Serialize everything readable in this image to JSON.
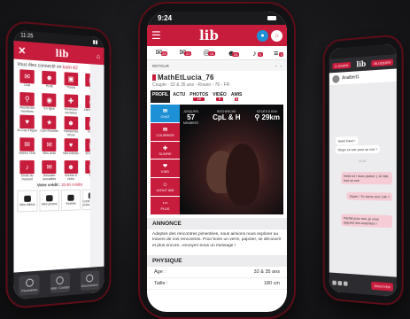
{
  "left": {
    "status_time": "11:25",
    "logo": "lib",
    "connected_text": "Vous êtes connecté en",
    "connected_user": "karin-62",
    "grid": [
      {
        "icon": "chat-icon",
        "label": "Chat"
      },
      {
        "icon": "user-icon",
        "label": "Profil"
      },
      {
        "icon": "photo-icon",
        "label": "Photos"
      },
      {
        "icon": "calendar-icon",
        "label": "Sort"
      },
      {
        "icon": "search-icon",
        "label": "Recherche membres"
      },
      {
        "icon": "online-icon",
        "label": "En ligne"
      },
      {
        "icon": "new-icon",
        "label": "Nouveaux membres"
      },
      {
        "icon": "eye-icon",
        "label": "J'aime vu ton"
      },
      {
        "icon": "heart-icon",
        "label": "Ai-Cop d'Appa"
      },
      {
        "icon": "star-icon",
        "label": "Cam Roulette"
      },
      {
        "icon": "user-icon",
        "label": "Fantasmes Vécus"
      },
      {
        "icon": "video-icon",
        "label": "Vidéos"
      },
      {
        "icon": "chat-icon",
        "label": "Salons Chat"
      },
      {
        "icon": "mail-icon",
        "label": "Mes amis"
      },
      {
        "icon": "heart-icon",
        "label": "Mes Intimes"
      },
      {
        "icon": "calendar-icon",
        "label": "Je kiffe ton"
      },
      {
        "icon": "bell-icon",
        "label": "Envie du moment"
      },
      {
        "icon": "mail-icon",
        "label": "Annuaire sexualités"
      },
      {
        "icon": "user-icon",
        "label": "Soirées & clubs"
      },
      {
        "icon": "bookmark-icon",
        "label": "Blog"
      }
    ],
    "credit_text": "Votre crédit :",
    "credit_value": "20.80 crédits",
    "social": [
      {
        "icon": "play-icon",
        "label": "Mes vidéos"
      },
      {
        "icon": "photo-icon",
        "label": "Mes photos"
      },
      {
        "icon": "play-icon",
        "label": "Youtube"
      },
      {
        "icon": "location-icon",
        "label": "Carte des clubs"
      }
    ],
    "bottom": [
      {
        "icon": "user-icon",
        "label": "Paramètres"
      },
      {
        "icon": "help-icon",
        "label": "Aide / Contact"
      },
      {
        "icon": "power-icon",
        "label": "Déconnexion"
      }
    ]
  },
  "center": {
    "status_time": "9:24",
    "logo": "lib",
    "top_icons": [
      {
        "icon": "mail-icon",
        "count": "28"
      },
      {
        "icon": "chat-icon",
        "count": "22"
      },
      {
        "icon": "eye-icon",
        "count": "14"
      },
      {
        "icon": "users-icon",
        "count": "28"
      },
      {
        "icon": "bell-icon",
        "count": "0"
      },
      {
        "icon": "list-icon",
        "count": "0"
      }
    ],
    "nav_back": "RETOUR",
    "profile_name": "MathEtLucia_76",
    "profile_loc": "Couple - 32 & 35 ans - Rouen - 76 - FR",
    "tabs": [
      {
        "label": "PROFIL",
        "count": ""
      },
      {
        "label": "ACTU",
        "count": ""
      },
      {
        "label": "PHOTOS",
        "count": "19"
      },
      {
        "label": "VIDÉO",
        "count": "0"
      },
      {
        "label": "AMIS",
        "count": "5"
      }
    ],
    "side_buttons": [
      {
        "icon": "chat-icon",
        "label": "CHAT"
      },
      {
        "icon": "mail-icon",
        "label": "COURRIER"
      },
      {
        "icon": "user-plus-icon",
        "label": "SUIVRE"
      },
      {
        "icon": "kiss-icon",
        "label": "KISS"
      },
      {
        "icon": "friend-icon",
        "label": "AJOUT AMI"
      },
      {
        "icon": "more-icon",
        "label": "PLUS"
      }
    ],
    "stats": [
      {
        "top": "JUSQU'EN",
        "value": "57",
        "bottom": "MEMBRES"
      },
      {
        "top": "RECHERCHE",
        "value": "CpL & H",
        "bottom": ""
      },
      {
        "top": "SITUÉS À ENV.",
        "value": "29km",
        "bottom": ""
      }
    ],
    "announce_title": "ANNONCE",
    "announce_text": "Adeptes des rencontres pimentées, nous aimions nous explorer au travers de nos rencontres. Pour boire un verre, papoter, se découvrir et plus encore...envoyez-nous un message !",
    "physique_title": "PHYSIQUE",
    "physique_rows": [
      {
        "label": "Age :",
        "value": "32 & 35 ans"
      },
      {
        "label": "Taille :",
        "value": "180 cm"
      }
    ]
  },
  "right": {
    "pill_left": "3 JOURS",
    "pill_right": "BLOQUER",
    "user": "Analbert1",
    "messages": [
      {
        "dir": "in",
        "text": "Salut Dave !"
      },
      {
        "dir": "in",
        "text": "Dispo ce soir pour se voir ?"
      },
      {
        "dir": "out",
        "text": "Hello toi ! Avec plaisir ;) Je fais tout ce soir"
      },
      {
        "dir": "out",
        "text": "Super ! Tu viens vers 19h ?"
      },
      {
        "dir": "out",
        "text": "Parfait pour moi, je vous apporte des surprises !"
      }
    ],
    "date_sep": "14:34",
    "send_label": "ENVOYER",
    "accent_color": "#c81c3c",
    "blue_color": "#1e90d6"
  }
}
